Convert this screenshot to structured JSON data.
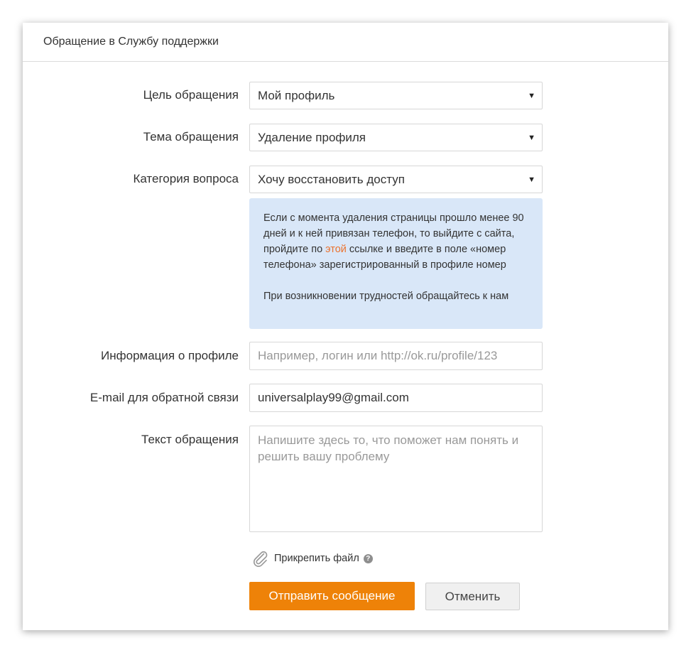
{
  "dialog": {
    "title": "Обращение в Службу поддержки"
  },
  "form": {
    "purpose": {
      "label": "Цель обращения",
      "value": "Мой профиль"
    },
    "topic": {
      "label": "Тема обращения",
      "value": "Удаление профиля"
    },
    "category": {
      "label": "Категория вопроса",
      "value": "Хочу восстановить доступ"
    },
    "info": {
      "text_before_link": "Если с момента удаления страницы прошло менее 90 дней и к ней привязан телефон, то выйдите с сайта, пройдите по ",
      "link_text": "этой",
      "text_after_link": " ссылке и введите в поле «номер телефона» зарегистрированный в профиле номер",
      "paragraph2": "При возникновении трудностей обращайтесь к нам"
    },
    "profile_info": {
      "label": "Информация о профиле",
      "value": "",
      "placeholder": "Например, логин или http://ok.ru/profile/123"
    },
    "email": {
      "label": "E-mail для обратной связи",
      "value": "universalplay99@gmail.com"
    },
    "message": {
      "label": "Текст обращения",
      "placeholder": "Напишите здесь то, что поможет нам понять и решить вашу проблему"
    },
    "attach": {
      "label": "Прикрепить файл",
      "help": "?"
    },
    "submit_label": "Отправить сообщение",
    "cancel_label": "Отменить",
    "arrow_glyph": "▼"
  },
  "colors": {
    "accent": "#ee8208",
    "link": "#eb722e",
    "info_bg": "#d9e7f8"
  },
  "icons": {
    "dropdown": "chevron-down-icon",
    "attach": "paperclip-icon",
    "help": "question-icon"
  }
}
